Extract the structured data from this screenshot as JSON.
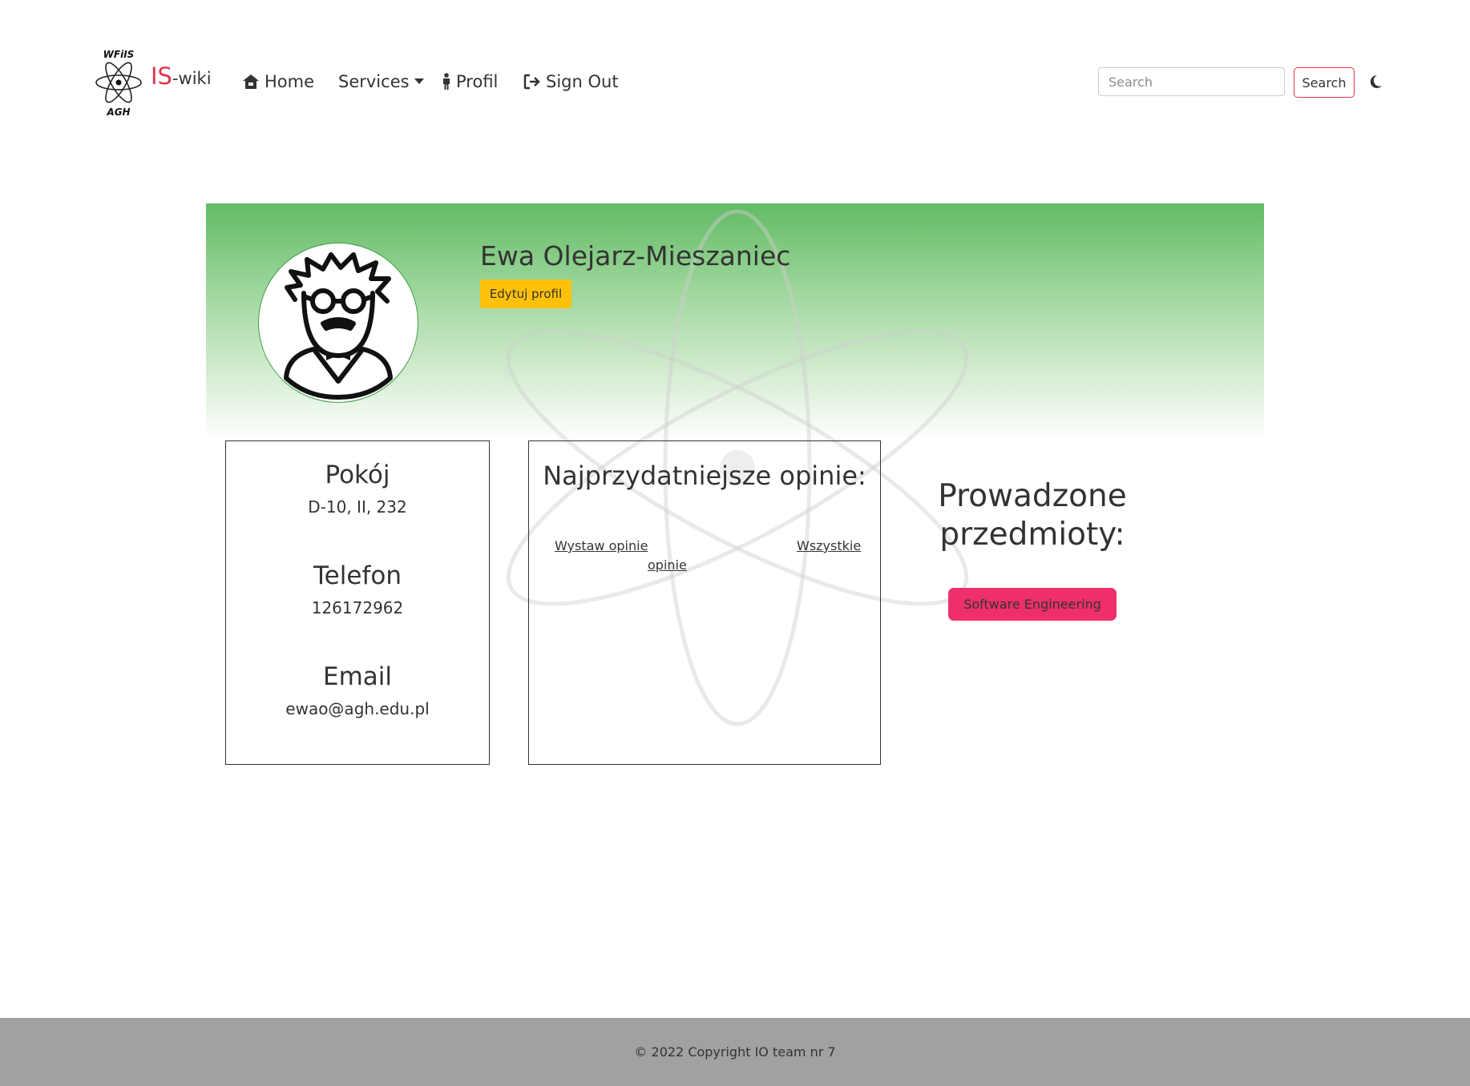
{
  "nav": {
    "brand_is": "IS",
    "brand_wiki": "-wiki",
    "logo_text_top": "WFiIS",
    "logo_text_bottom": "AGH",
    "items": [
      {
        "label": "Home",
        "icon": "home-icon"
      },
      {
        "label": "Services",
        "icon": "caret-down-icon"
      },
      {
        "label": "Profil",
        "icon": "person-icon"
      },
      {
        "label": "Sign Out",
        "icon": "sign-out-icon"
      }
    ],
    "search_placeholder": "Search",
    "search_button": "Search",
    "theme_icon": "moon-icon"
  },
  "profile": {
    "name": "Ewa Olejarz-Mieszaniec",
    "edit_button": "Edytuj profil",
    "avatar_icon": "scientist-avatar-icon"
  },
  "info": {
    "room_label": "Pokój",
    "room_value": "D-10, II, 232",
    "phone_label": "Telefon",
    "phone_value": "126172962",
    "email_label": "Email",
    "email_value": "ewao@agh.edu.pl"
  },
  "opinions": {
    "title": "Najprzydatniejsze opinie:",
    "add_link": "Wystaw opinie",
    "all_link_part1": "Wszystkie",
    "all_link_part2": "opinie"
  },
  "courses": {
    "title": "Prowadzone przedmioty:",
    "items": [
      "Software Engineering"
    ]
  },
  "footer": {
    "text": "© 2022 Copyright IO team nr 7"
  },
  "colors": {
    "brand_red": "#e0344f",
    "hero_green": "#62bb65",
    "edit_yellow": "#ffc107",
    "course_pink": "#ee2f6b",
    "footer_gray": "#a0a1a3"
  }
}
